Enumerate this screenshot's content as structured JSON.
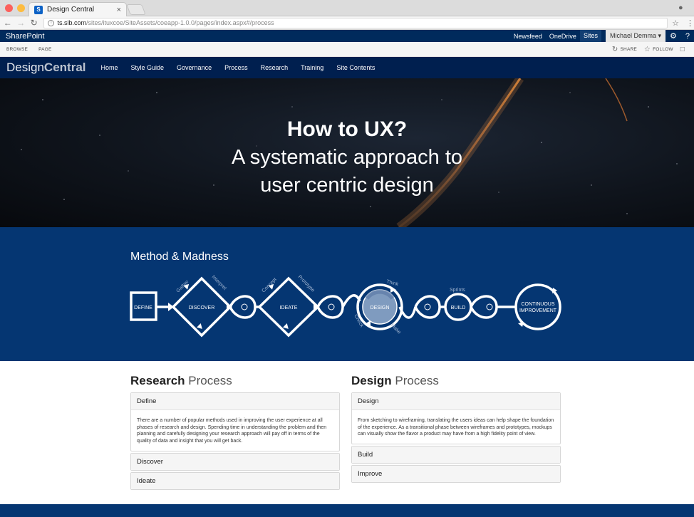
{
  "browser": {
    "tab_title": "Design Central",
    "tab_close": "×",
    "url_host": "ts.slb.com",
    "url_path": "/sites/ituxcoe/SiteAssets/coeapp-1.0.0/pages/index.aspx#/process",
    "light_colors": [
      "#fc605c",
      "#fdbc40",
      "#34c84a"
    ]
  },
  "sharepoint": {
    "brand": "SharePoint",
    "links": [
      "Newsfeed",
      "OneDrive",
      "Sites"
    ],
    "user": "Michael Demma ▾",
    "ribbon_tabs": [
      "BROWSE",
      "PAGE"
    ],
    "share_label": "SHARE",
    "follow_label": "FOLLOW"
  },
  "site": {
    "logo_light": "Design",
    "logo_bold": "Central",
    "nav": [
      "Home",
      "Style Guide",
      "Governance",
      "Process",
      "Research",
      "Training",
      "Site Contents"
    ]
  },
  "hero": {
    "title": "How to UX?",
    "subtitle_line1": "A systematic approach to",
    "subtitle_line2": "user centric design"
  },
  "method": {
    "title": "Method & Madness",
    "nodes": {
      "define": "DEFINE",
      "discover": "DISCOVER",
      "ideate": "IDEATE",
      "design": "DESIGN",
      "build": "BUILD",
      "continuous_line1": "CONTINUOUS",
      "continuous_line2": "IMPROVEMENT"
    },
    "labels": {
      "gather": "Gather",
      "interpret": "Interpret",
      "concept": "Concept",
      "prototype": "Prototype",
      "think": "Think",
      "make": "Make",
      "check": "Check",
      "sprints": "Sprints"
    },
    "colors": {
      "bg": "#053672",
      "design_fill": "#7f9bbf"
    }
  },
  "research": {
    "title_bold": "Research",
    "title_light": "Process",
    "items": [
      {
        "label": "Define",
        "body": "There are a number of popular methods used in improving the user experience at all phases of research and design. Spending time in understanding the problem and then planning and carefully designing your research approach will pay off in terms of the quality of data and insight that you will get back."
      },
      {
        "label": "Discover"
      },
      {
        "label": "Ideate"
      }
    ]
  },
  "design": {
    "title_bold": "Design",
    "title_light": "Process",
    "items": [
      {
        "label": "Design",
        "body": "From sketching to wireframing, translating the users ideas can help shape the foundation of the experience. As a transitional phase between wireframes and prototypes, mockups can visually show the flavor a product may have from a high fidelity point of view."
      },
      {
        "label": "Build"
      },
      {
        "label": "Improve"
      }
    ]
  }
}
